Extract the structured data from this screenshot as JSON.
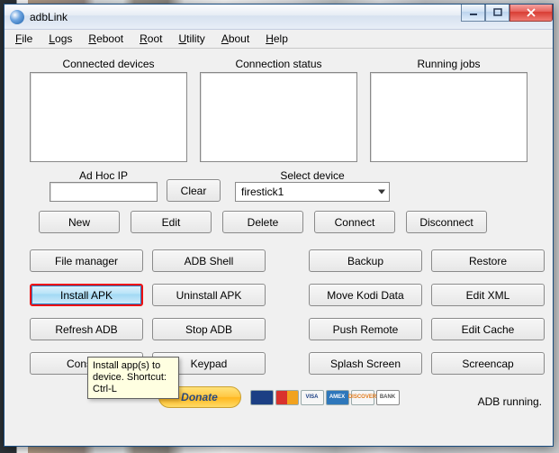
{
  "window": {
    "title": "adbLink"
  },
  "menu": {
    "file": "File",
    "logs": "Logs",
    "reboot": "Reboot",
    "root": "Root",
    "utility": "Utility",
    "about": "About",
    "help": "Help"
  },
  "panels": {
    "connected": "Connected devices",
    "connection": "Connection status",
    "running": "Running jobs"
  },
  "adhoc": {
    "label": "Ad Hoc IP",
    "value": "",
    "clear": "Clear"
  },
  "select": {
    "label": "Select device",
    "value": "firestick1"
  },
  "devbtns": {
    "new": "New",
    "edit": "Edit",
    "delete": "Delete",
    "connect": "Connect",
    "disconnect": "Disconnect"
  },
  "grid": {
    "file_manager": "File manager",
    "adb_shell": "ADB Shell",
    "backup": "Backup",
    "restore": "Restore",
    "install_apk": "Install APK",
    "uninstall_apk": "Uninstall APK",
    "move_kodi": "Move Kodi Data",
    "edit_xml": "Edit XML",
    "refresh_adb": "Refresh ADB",
    "stop_adb": "Stop ADB",
    "push_remote": "Push Remote",
    "edit_cache": "Edit Cache",
    "console": "Console",
    "keypad": "Keypad",
    "splash": "Splash Screen",
    "screencap": "Screencap"
  },
  "donate": "Donate",
  "cards": {
    "visa": "VISA",
    "amex": "AMEX",
    "disc": "DISCOVER",
    "bank": "BANK"
  },
  "status": "ADB running.",
  "tooltip": "Install app(s) to device. Shortcut: Ctrl-L"
}
